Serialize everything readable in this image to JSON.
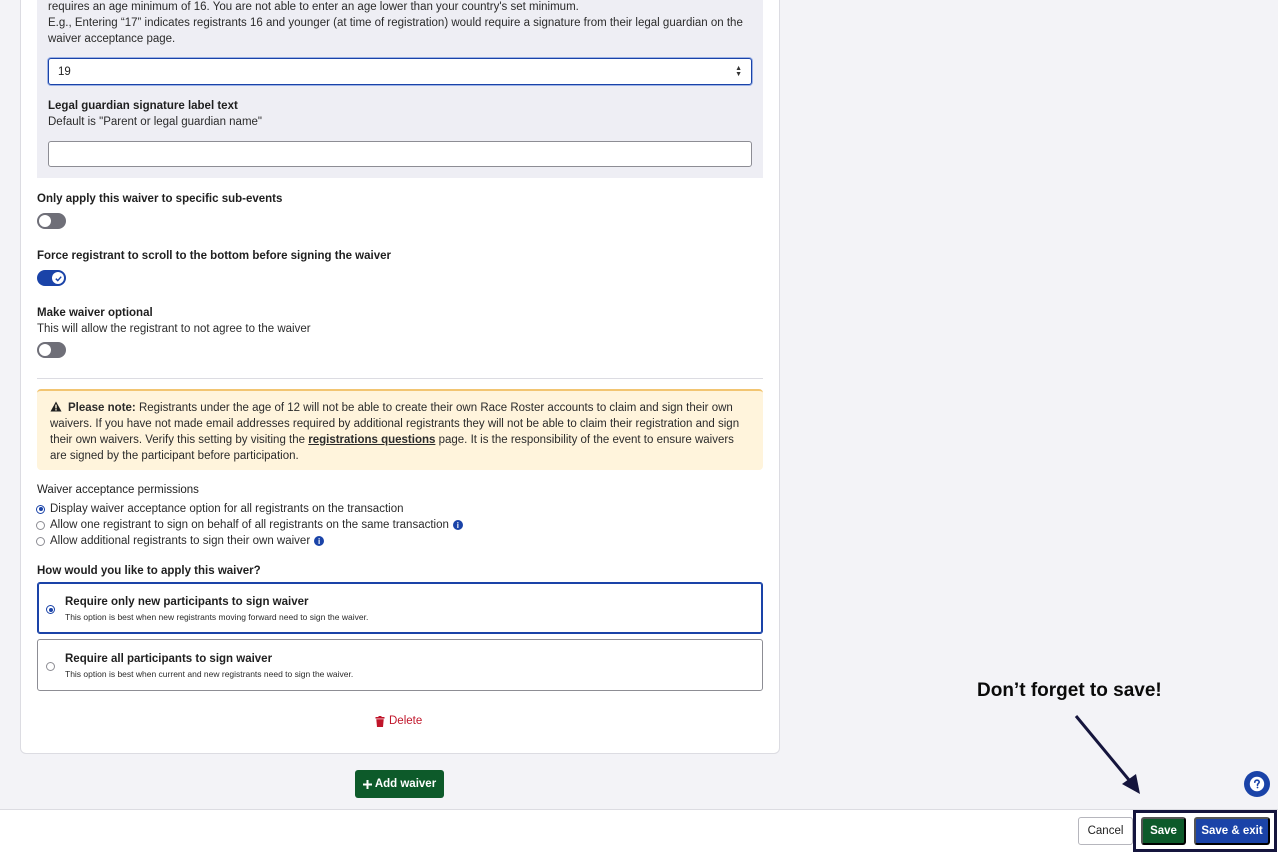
{
  "age_section": {
    "description_line1": "requires an age minimum of 16. You are not able to enter an age lower than your country's set minimum.",
    "description_line2": "E.g., Entering “17” indicates registrants 16 and younger (at time of registration) would require a signature from their legal guardian on the",
    "description_line3": "waiver acceptance page.",
    "age_value": "19",
    "guardian_label": "Legal guardian signature label text",
    "guardian_default": "Default is \"Parent or legal guardian name\"",
    "guardian_value": ""
  },
  "toggles": {
    "sub_events_label": "Only apply this waiver to specific sub-events",
    "sub_events_on": false,
    "force_scroll_label": "Force registrant to scroll to the bottom before signing the waiver",
    "force_scroll_on": true,
    "optional_label": "Make waiver optional",
    "optional_desc": "This will allow the registrant to not agree to the waiver",
    "optional_on": false
  },
  "note": {
    "heading": "Please note:",
    "text1": " Registrants under the age of 12 will not be able to create their own Race Roster accounts to claim and sign their own waivers. If you have not made email addresses required by additional registrants they will not be able to claim their registration and sign their own waivers. Verify this setting by visiting the ",
    "link": "registrations questions",
    "text2": " page. It is the responsibility of the event to ensure waivers are signed by the participant before participation."
  },
  "permissions": {
    "title": "Waiver acceptance permissions",
    "options": [
      {
        "label": "Display waiver acceptance option for all registrants on the transaction",
        "checked": true
      },
      {
        "label": "Allow one registrant to sign on behalf of all registrants on the same transaction",
        "checked": false
      },
      {
        "label": "Allow additional registrants to sign their own waiver",
        "checked": false
      }
    ]
  },
  "apply": {
    "title": "How would you like to apply this waiver?",
    "options": [
      {
        "title": "Require only new participants to sign waiver",
        "desc": "This option is best when new registrants moving forward need to sign the waiver.",
        "selected": true
      },
      {
        "title": "Require all participants to sign waiver",
        "desc": "This option is best when current and new registrants need to sign the waiver.",
        "selected": false
      }
    ]
  },
  "actions": {
    "delete_label": "Delete",
    "add_waiver_label": "Add waiver",
    "cancel_label": "Cancel",
    "save_label": "Save",
    "save_exit_label": "Save & exit"
  },
  "annotation": {
    "reminder": "Don’t forget to save!"
  },
  "colors": {
    "primary_blue": "#1a43a8",
    "primary_green": "#0d5a2a",
    "danger": "#c0152a",
    "note_bg": "#fff4dc"
  }
}
